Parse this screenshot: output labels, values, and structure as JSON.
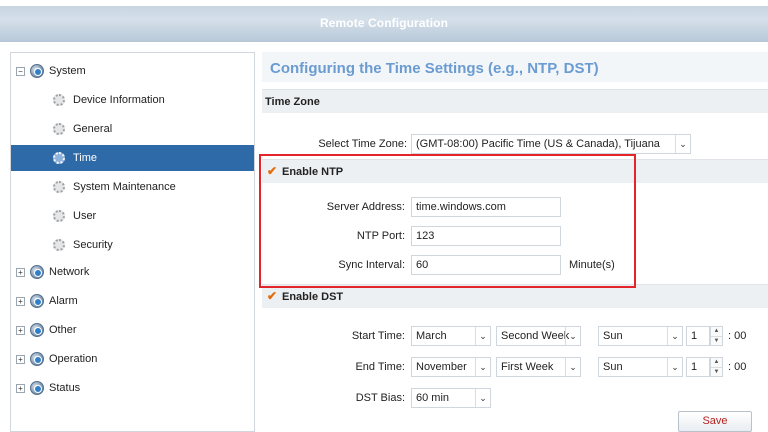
{
  "window": {
    "title": "Remote Configuration"
  },
  "sidebar": {
    "items": [
      {
        "label": "System",
        "expander": "−",
        "icon": "globe-gear-icon"
      },
      {
        "label": "Device Information",
        "icon": "gear-icon"
      },
      {
        "label": "General",
        "icon": "gear-icon"
      },
      {
        "label": "Time",
        "icon": "gear-icon",
        "selected": true
      },
      {
        "label": "System Maintenance",
        "icon": "gear-icon"
      },
      {
        "label": "User",
        "icon": "gear-icon"
      },
      {
        "label": "Security",
        "icon": "gear-icon"
      },
      {
        "label": "Network",
        "expander": "+",
        "icon": "globe-gear-icon"
      },
      {
        "label": "Alarm",
        "expander": "+",
        "icon": "globe-gear-icon"
      },
      {
        "label": "Other",
        "expander": "+",
        "icon": "globe-gear-icon"
      },
      {
        "label": "Operation",
        "expander": "+",
        "icon": "globe-gear-icon"
      },
      {
        "label": "Status",
        "expander": "+",
        "icon": "globe-gear-icon"
      }
    ]
  },
  "main": {
    "page_title": "Configuring the Time Settings (e.g., NTP, DST)",
    "time_zone": {
      "section_label": "Time Zone",
      "select_label": "Select Time Zone:",
      "select_value": "(GMT-08:00) Pacific Time (US & Canada), Tijuana"
    },
    "ntp": {
      "section_label": "Enable NTP",
      "server_label": "Server Address:",
      "server_value": "time.windows.com",
      "port_label": "NTP Port:",
      "port_value": "123",
      "interval_label": "Sync Interval:",
      "interval_value": "60",
      "interval_unit": "Minute(s)"
    },
    "dst": {
      "section_label": "Enable DST",
      "start_label": "Start Time:",
      "start_month": "March",
      "start_week": "Second Week",
      "start_day": "Sun",
      "start_hour": "1",
      "start_suffix": ": 00",
      "end_label": "End Time:",
      "end_month": "November",
      "end_week": "First Week",
      "end_day": "Sun",
      "end_hour": "1",
      "end_suffix": ": 00",
      "bias_label": "DST Bias:",
      "bias_value": "60 min"
    },
    "save_label": "Save"
  },
  "colors": {
    "accent": "#2e6aa8",
    "title_text": "#6a9bd1",
    "highlight_box": "#e3242b",
    "check": "#e36c0a"
  }
}
